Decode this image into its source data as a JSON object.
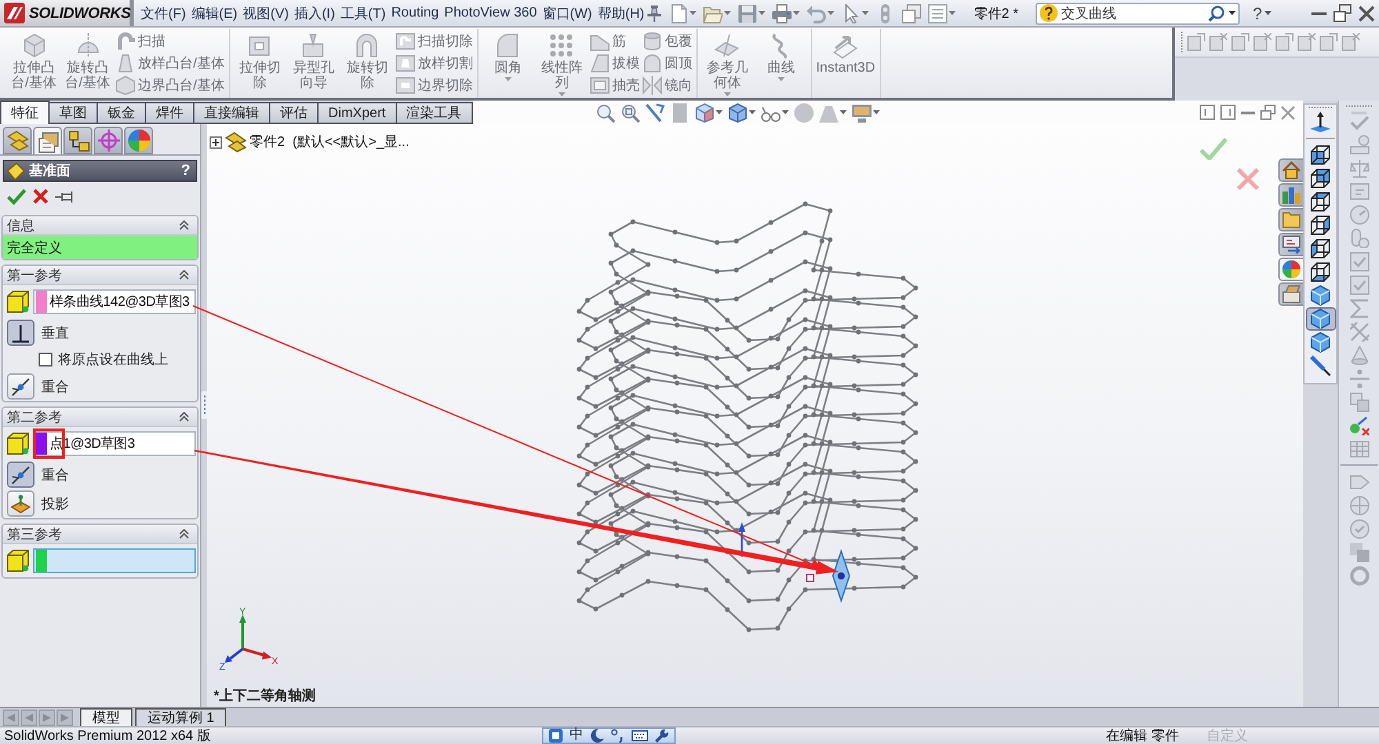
{
  "title_bar": {
    "logo": "SOLIDWORKS",
    "menus": [
      "文件(F)",
      "编辑(E)",
      "视图(V)",
      "插入(I)",
      "工具(T)",
      "Routing",
      "PhotoView 360",
      "窗口(W)",
      "帮助(H)"
    ],
    "document_title": "零件2 *",
    "search": {
      "value": "交叉曲线"
    },
    "help": "?"
  },
  "command_manager": {
    "disabled": true,
    "groups": [
      {
        "items": [
          {
            "kind": "large",
            "label": "拉伸凸台/基体",
            "dropdown": false
          },
          {
            "kind": "large",
            "label": "旋转凸台/基体",
            "dropdown": false
          },
          {
            "kind": "stack",
            "labels": [
              "扫描",
              "放样凸台/基体",
              "边界凸台/基体"
            ]
          }
        ]
      },
      {
        "items": [
          {
            "kind": "large",
            "label": "拉伸切除",
            "dropdown": false
          },
          {
            "kind": "large",
            "label": "异型孔向导",
            "dropdown": false
          },
          {
            "kind": "large",
            "label": "旋转切除",
            "dropdown": false
          },
          {
            "kind": "stack",
            "labels": [
              "扫描切除",
              "放样切割",
              "边界切除"
            ]
          }
        ]
      },
      {
        "items": [
          {
            "kind": "large",
            "label": "圆角",
            "dropdown": true
          },
          {
            "kind": "large",
            "label": "线性阵列",
            "dropdown": true
          },
          {
            "kind": "stack",
            "labels": [
              "筋",
              "拔模",
              "抽壳"
            ]
          },
          {
            "kind": "stack",
            "labels": [
              "包覆",
              "圆顶",
              "镜向"
            ]
          }
        ]
      },
      {
        "items": [
          {
            "kind": "large",
            "label": "参考几何体",
            "dropdown": true
          },
          {
            "kind": "large",
            "label": "曲线",
            "dropdown": true
          }
        ]
      },
      {
        "items": [
          {
            "kind": "large",
            "label": "Instant3D",
            "dropdown": false
          }
        ]
      }
    ]
  },
  "command_tabs": [
    {
      "label": "特征",
      "selected": true
    },
    {
      "label": "草图",
      "selected": false
    },
    {
      "label": "钣金",
      "selected": false
    },
    {
      "label": "焊件",
      "selected": false
    },
    {
      "label": "直接编辑",
      "selected": false
    },
    {
      "label": "评估",
      "selected": false
    },
    {
      "label": "DimXpert",
      "selected": false
    },
    {
      "label": "渲染工具",
      "selected": false
    }
  ],
  "property_manager": {
    "panel_tabs": [
      {
        "selected": false
      },
      {
        "selected": true
      },
      {
        "selected": false
      },
      {
        "selected": false
      },
      {
        "selected": false
      }
    ],
    "title": "基准面",
    "help": "?",
    "sections": [
      {
        "kind": "message",
        "title": "信息",
        "message": "完全定义"
      },
      {
        "kind": "reference",
        "title": "第一参考",
        "field": {
          "value": "样条曲线142@3D草图3",
          "color": "#f07ec8",
          "active": false
        },
        "options": [
          {
            "kind": "perpendicular",
            "label": "垂直",
            "selected": true
          },
          {
            "kind": "checkbox",
            "label": "将原点设在曲线上",
            "checked": false
          },
          {
            "kind": "coincident",
            "label": "重合",
            "selected": false
          }
        ]
      },
      {
        "kind": "reference",
        "title": "第二参考",
        "field": {
          "value": "点1@3D草图3",
          "color": "#8a10f0",
          "active": false,
          "annotation_box": true
        },
        "options": [
          {
            "kind": "coincident",
            "label": "重合",
            "selected": true
          },
          {
            "kind": "projection",
            "label": "投影",
            "selected": false
          }
        ]
      },
      {
        "kind": "reference",
        "title": "第三参考",
        "field": {
          "color": "#1ed24a",
          "active": true
        }
      }
    ]
  },
  "feature_tree": {
    "expanded": false,
    "label": "零件2  (默认<<默认>_显..."
  },
  "view": {
    "orientation": "*上下二等角轴测",
    "triad_axes": [
      "Y",
      "X",
      "Z"
    ]
  },
  "task_pane_tabs": [
    {
      "selected": false
    },
    {
      "selected": false
    },
    {
      "selected": false
    },
    {
      "selected": false
    },
    {
      "selected": true
    },
    {
      "selected": false
    }
  ],
  "view_toolbar": [
    {
      "selected": false
    },
    {
      "selected": false
    },
    {
      "selected": false
    },
    {
      "selected": false
    },
    {
      "selected": false
    },
    {
      "selected": false
    },
    {
      "selected": false
    },
    {
      "selected": false
    },
    {
      "selected": true
    },
    {
      "selected": false
    },
    {
      "selected": false
    }
  ],
  "bottom_tabs": [
    {
      "label": "模型",
      "selected": true
    },
    {
      "label": "运动算例 1",
      "selected": false
    }
  ],
  "status_bar": {
    "product": "SolidWorks Premium 2012 x64 版",
    "ime_mode": "中",
    "edit_state": "在编辑 零件",
    "customize": "自定义"
  }
}
